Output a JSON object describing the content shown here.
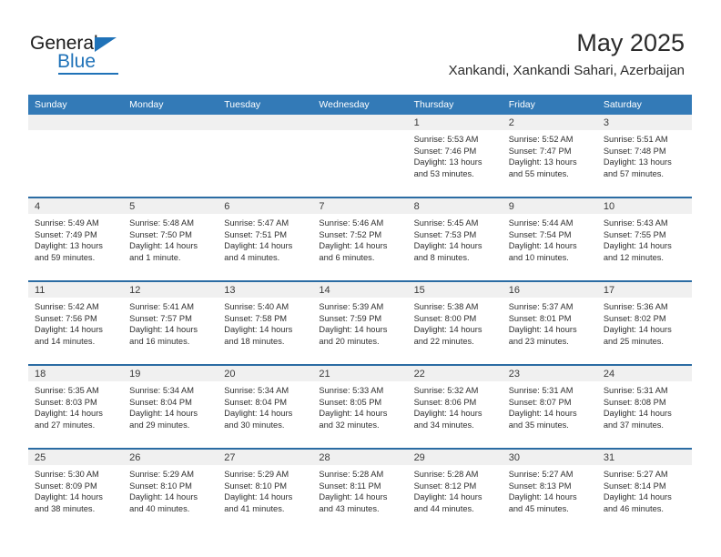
{
  "brand": {
    "name_part1": "General",
    "name_part2": "Blue"
  },
  "header": {
    "title": "May 2025",
    "subtitle": "Xankandi, Xankandi Sahari, Azerbaijan"
  },
  "colors": {
    "header_blue": "#337ab7",
    "week_divider": "#2b6ca3",
    "daynum_band": "#f0f0f0",
    "brand_blue": "#1f72b8"
  },
  "weekdays": [
    "Sunday",
    "Monday",
    "Tuesday",
    "Wednesday",
    "Thursday",
    "Friday",
    "Saturday"
  ],
  "weeks": [
    [
      {
        "day": "",
        "sunrise": "",
        "sunset": "",
        "daylight": "",
        "daylight2": ""
      },
      {
        "day": "",
        "sunrise": "",
        "sunset": "",
        "daylight": "",
        "daylight2": ""
      },
      {
        "day": "",
        "sunrise": "",
        "sunset": "",
        "daylight": "",
        "daylight2": ""
      },
      {
        "day": "",
        "sunrise": "",
        "sunset": "",
        "daylight": "",
        "daylight2": ""
      },
      {
        "day": "1",
        "sunrise": "Sunrise: 5:53 AM",
        "sunset": "Sunset: 7:46 PM",
        "daylight": "Daylight: 13 hours",
        "daylight2": "and 53 minutes."
      },
      {
        "day": "2",
        "sunrise": "Sunrise: 5:52 AM",
        "sunset": "Sunset: 7:47 PM",
        "daylight": "Daylight: 13 hours",
        "daylight2": "and 55 minutes."
      },
      {
        "day": "3",
        "sunrise": "Sunrise: 5:51 AM",
        "sunset": "Sunset: 7:48 PM",
        "daylight": "Daylight: 13 hours",
        "daylight2": "and 57 minutes."
      }
    ],
    [
      {
        "day": "4",
        "sunrise": "Sunrise: 5:49 AM",
        "sunset": "Sunset: 7:49 PM",
        "daylight": "Daylight: 13 hours",
        "daylight2": "and 59 minutes."
      },
      {
        "day": "5",
        "sunrise": "Sunrise: 5:48 AM",
        "sunset": "Sunset: 7:50 PM",
        "daylight": "Daylight: 14 hours",
        "daylight2": "and 1 minute."
      },
      {
        "day": "6",
        "sunrise": "Sunrise: 5:47 AM",
        "sunset": "Sunset: 7:51 PM",
        "daylight": "Daylight: 14 hours",
        "daylight2": "and 4 minutes."
      },
      {
        "day": "7",
        "sunrise": "Sunrise: 5:46 AM",
        "sunset": "Sunset: 7:52 PM",
        "daylight": "Daylight: 14 hours",
        "daylight2": "and 6 minutes."
      },
      {
        "day": "8",
        "sunrise": "Sunrise: 5:45 AM",
        "sunset": "Sunset: 7:53 PM",
        "daylight": "Daylight: 14 hours",
        "daylight2": "and 8 minutes."
      },
      {
        "day": "9",
        "sunrise": "Sunrise: 5:44 AM",
        "sunset": "Sunset: 7:54 PM",
        "daylight": "Daylight: 14 hours",
        "daylight2": "and 10 minutes."
      },
      {
        "day": "10",
        "sunrise": "Sunrise: 5:43 AM",
        "sunset": "Sunset: 7:55 PM",
        "daylight": "Daylight: 14 hours",
        "daylight2": "and 12 minutes."
      }
    ],
    [
      {
        "day": "11",
        "sunrise": "Sunrise: 5:42 AM",
        "sunset": "Sunset: 7:56 PM",
        "daylight": "Daylight: 14 hours",
        "daylight2": "and 14 minutes."
      },
      {
        "day": "12",
        "sunrise": "Sunrise: 5:41 AM",
        "sunset": "Sunset: 7:57 PM",
        "daylight": "Daylight: 14 hours",
        "daylight2": "and 16 minutes."
      },
      {
        "day": "13",
        "sunrise": "Sunrise: 5:40 AM",
        "sunset": "Sunset: 7:58 PM",
        "daylight": "Daylight: 14 hours",
        "daylight2": "and 18 minutes."
      },
      {
        "day": "14",
        "sunrise": "Sunrise: 5:39 AM",
        "sunset": "Sunset: 7:59 PM",
        "daylight": "Daylight: 14 hours",
        "daylight2": "and 20 minutes."
      },
      {
        "day": "15",
        "sunrise": "Sunrise: 5:38 AM",
        "sunset": "Sunset: 8:00 PM",
        "daylight": "Daylight: 14 hours",
        "daylight2": "and 22 minutes."
      },
      {
        "day": "16",
        "sunrise": "Sunrise: 5:37 AM",
        "sunset": "Sunset: 8:01 PM",
        "daylight": "Daylight: 14 hours",
        "daylight2": "and 23 minutes."
      },
      {
        "day": "17",
        "sunrise": "Sunrise: 5:36 AM",
        "sunset": "Sunset: 8:02 PM",
        "daylight": "Daylight: 14 hours",
        "daylight2": "and 25 minutes."
      }
    ],
    [
      {
        "day": "18",
        "sunrise": "Sunrise: 5:35 AM",
        "sunset": "Sunset: 8:03 PM",
        "daylight": "Daylight: 14 hours",
        "daylight2": "and 27 minutes."
      },
      {
        "day": "19",
        "sunrise": "Sunrise: 5:34 AM",
        "sunset": "Sunset: 8:04 PM",
        "daylight": "Daylight: 14 hours",
        "daylight2": "and 29 minutes."
      },
      {
        "day": "20",
        "sunrise": "Sunrise: 5:34 AM",
        "sunset": "Sunset: 8:04 PM",
        "daylight": "Daylight: 14 hours",
        "daylight2": "and 30 minutes."
      },
      {
        "day": "21",
        "sunrise": "Sunrise: 5:33 AM",
        "sunset": "Sunset: 8:05 PM",
        "daylight": "Daylight: 14 hours",
        "daylight2": "and 32 minutes."
      },
      {
        "day": "22",
        "sunrise": "Sunrise: 5:32 AM",
        "sunset": "Sunset: 8:06 PM",
        "daylight": "Daylight: 14 hours",
        "daylight2": "and 34 minutes."
      },
      {
        "day": "23",
        "sunrise": "Sunrise: 5:31 AM",
        "sunset": "Sunset: 8:07 PM",
        "daylight": "Daylight: 14 hours",
        "daylight2": "and 35 minutes."
      },
      {
        "day": "24",
        "sunrise": "Sunrise: 5:31 AM",
        "sunset": "Sunset: 8:08 PM",
        "daylight": "Daylight: 14 hours",
        "daylight2": "and 37 minutes."
      }
    ],
    [
      {
        "day": "25",
        "sunrise": "Sunrise: 5:30 AM",
        "sunset": "Sunset: 8:09 PM",
        "daylight": "Daylight: 14 hours",
        "daylight2": "and 38 minutes."
      },
      {
        "day": "26",
        "sunrise": "Sunrise: 5:29 AM",
        "sunset": "Sunset: 8:10 PM",
        "daylight": "Daylight: 14 hours",
        "daylight2": "and 40 minutes."
      },
      {
        "day": "27",
        "sunrise": "Sunrise: 5:29 AM",
        "sunset": "Sunset: 8:10 PM",
        "daylight": "Daylight: 14 hours",
        "daylight2": "and 41 minutes."
      },
      {
        "day": "28",
        "sunrise": "Sunrise: 5:28 AM",
        "sunset": "Sunset: 8:11 PM",
        "daylight": "Daylight: 14 hours",
        "daylight2": "and 43 minutes."
      },
      {
        "day": "29",
        "sunrise": "Sunrise: 5:28 AM",
        "sunset": "Sunset: 8:12 PM",
        "daylight": "Daylight: 14 hours",
        "daylight2": "and 44 minutes."
      },
      {
        "day": "30",
        "sunrise": "Sunrise: 5:27 AM",
        "sunset": "Sunset: 8:13 PM",
        "daylight": "Daylight: 14 hours",
        "daylight2": "and 45 minutes."
      },
      {
        "day": "31",
        "sunrise": "Sunrise: 5:27 AM",
        "sunset": "Sunset: 8:14 PM",
        "daylight": "Daylight: 14 hours",
        "daylight2": "and 46 minutes."
      }
    ]
  ]
}
